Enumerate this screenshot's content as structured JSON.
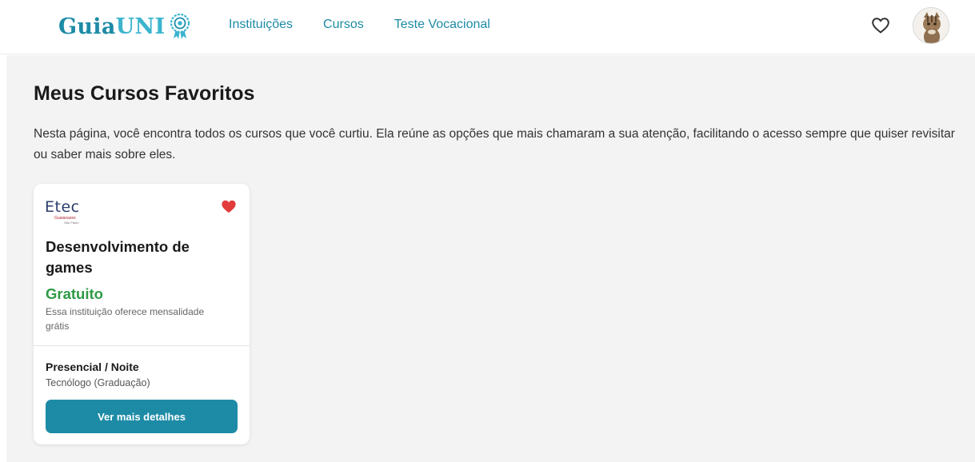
{
  "header": {
    "logo_part1": "Guia",
    "logo_part2": "UNI",
    "nav": [
      "Instituições",
      "Cursos",
      "Teste Vocacional"
    ]
  },
  "page": {
    "title": "Meus Cursos Favoritos",
    "description": "Nesta página, você encontra todos os cursos que você curtiu. Ela reúne as opções que mais chamaram a sua atenção, facilitando o acesso sempre que quiser revisitar ou saber mais sobre eles."
  },
  "favorites": [
    {
      "institution_logo_text": "Etec",
      "institution_logo_sub1": "Guaianazes",
      "institution_logo_sub2": "São Paulo",
      "course_title": "Desenvolvimento de games",
      "price": "Gratuito",
      "price_note": "Essa instituição oferece mensalidade grátis",
      "modality": "Presencial / Noite",
      "degree": "Tecnólogo (Graduação)",
      "button_label": "Ver mais detalhes",
      "favorited": true
    }
  ],
  "icons": {
    "logo_badge": "award-ribbon-icon",
    "favorites_nav": "heart-outline-icon",
    "card_favorite": "heart-filled-icon"
  },
  "colors": {
    "brand": "#1d8ba6",
    "brand_light": "#3cb4ce",
    "price_green": "#2e9a45",
    "heart_red": "#e23b3b"
  }
}
